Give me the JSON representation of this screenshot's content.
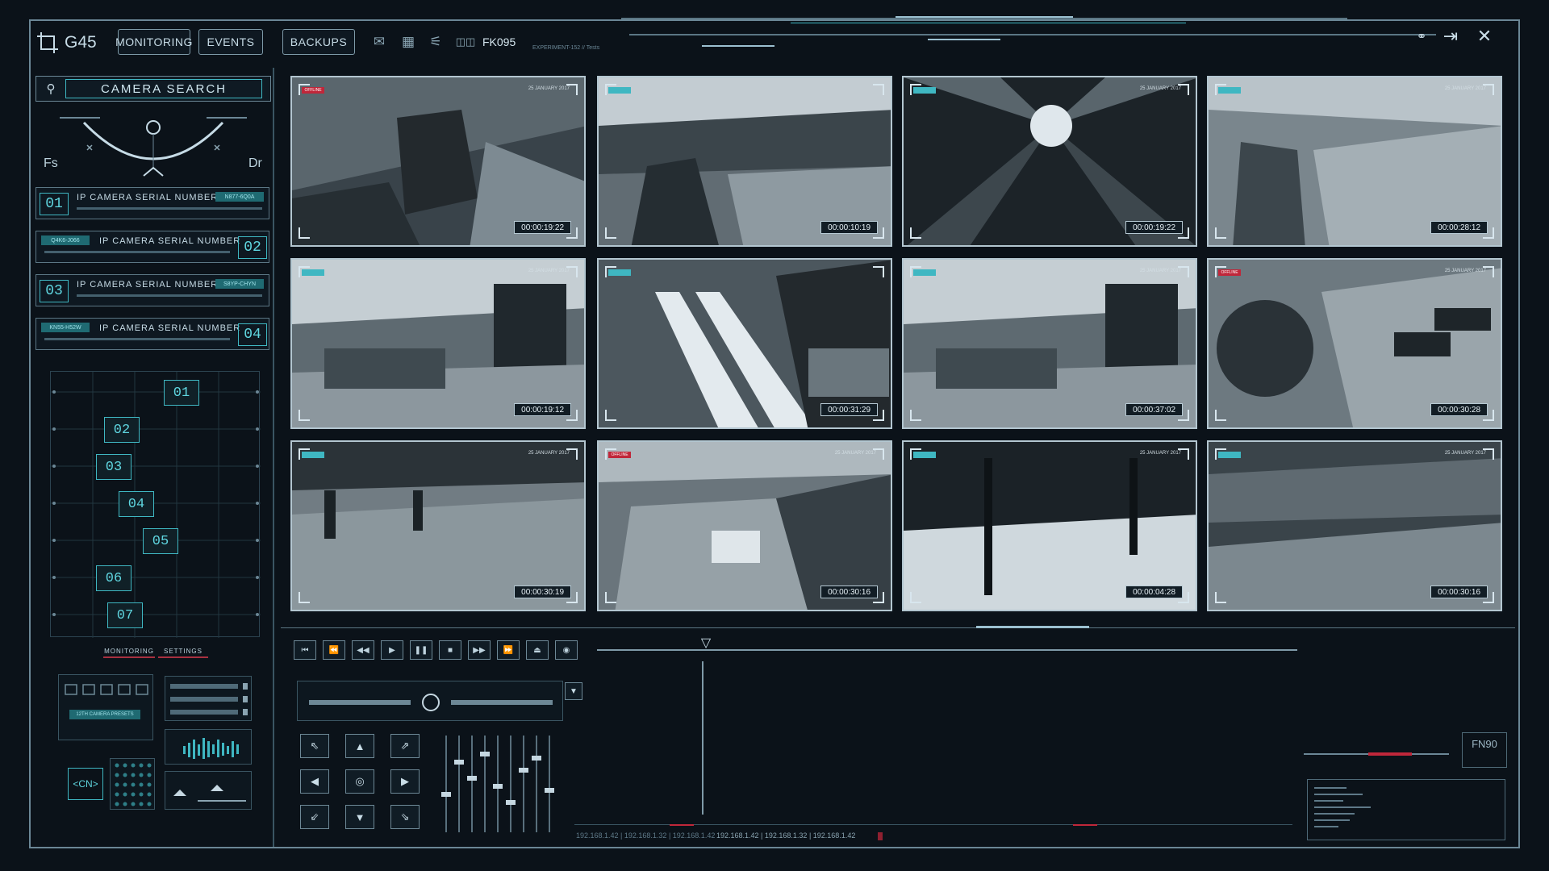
{
  "app": {
    "logo": "G45"
  },
  "toolbar": {
    "tabs": [
      "MONITORING",
      "EVENTS",
      "BACKUPS"
    ],
    "camera_code": "FK095",
    "experiment_label": "EXPERIMENT-152 // Tests"
  },
  "search": {
    "label": "CAMERA SEARCH"
  },
  "gauge": {
    "left": "Fs",
    "right": "Dr"
  },
  "camera_list": [
    {
      "num": "01",
      "title": "IP CAMERA SERIAL NUMBER",
      "serial": "N877-6Q0A"
    },
    {
      "num": "02",
      "title": "IP CAMERA SERIAL NUMBER",
      "serial": "Q4K6-J066"
    },
    {
      "num": "03",
      "title": "IP CAMERA SERIAL NUMBER",
      "serial": "S8YP-CHYN"
    },
    {
      "num": "04",
      "title": "IP CAMERA SERIAL NUMBER",
      "serial": "KN55-H52W"
    }
  ],
  "nodes": [
    "01",
    "02",
    "03",
    "04",
    "05",
    "06",
    "07"
  ],
  "bottom_tabs": {
    "monitoring": "MONITORING",
    "settings": "SETTINGS"
  },
  "presets_label": "12TH CAMERA PRESETS",
  "cn_label": "<CN>",
  "tiles": [
    {
      "ts": "00:00:19:22",
      "badge": "OFFLINE",
      "date": "25 JANUARY 2017"
    },
    {
      "ts": "00:00:10:19",
      "badge": "",
      "date": ""
    },
    {
      "ts": "00:00:19:22",
      "badge": "",
      "date": "25 JANUARY 2017"
    },
    {
      "ts": "00:00:28:12",
      "badge": "",
      "date": "25 JANUARY 2017"
    },
    {
      "ts": "00:00:19:12",
      "badge": "",
      "date": "25 JANUARY 2017"
    },
    {
      "ts": "00:00:31:29",
      "badge": "",
      "date": ""
    },
    {
      "ts": "00:00:37:02",
      "badge": "",
      "date": "25 JANUARY 2017"
    },
    {
      "ts": "00:00:30:28",
      "badge": "OFFLINE",
      "date": "25 JANUARY 2017"
    },
    {
      "ts": "00:00:30:19",
      "badge": "",
      "date": "25 JANUARY 2017"
    },
    {
      "ts": "00:00:30:16",
      "badge": "OFFLINE",
      "date": "25 JANUARY 2017"
    },
    {
      "ts": "00:00:04:28",
      "badge": "",
      "date": "25 JANUARY 2017"
    },
    {
      "ts": "00:00:30:16",
      "badge": "",
      "date": "25 JANUARY 2017"
    }
  ],
  "fn_label": "FN90",
  "ip_text": "192.168.1.42  |  192.168.1.32  |  192.168.1.42",
  "colors": {
    "accent": "#3fb7c2",
    "alert": "#c0273a",
    "frame": "#6b8796"
  }
}
